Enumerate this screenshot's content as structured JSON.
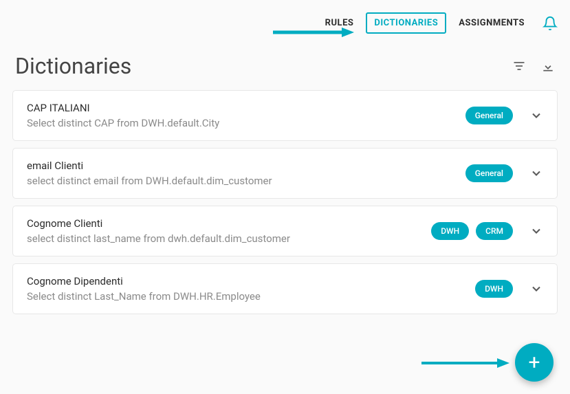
{
  "header": {
    "tabs": [
      {
        "label": "RULES",
        "active": false
      },
      {
        "label": "DICTIONARIES",
        "active": true
      },
      {
        "label": "ASSIGNMENTS",
        "active": false
      }
    ]
  },
  "page": {
    "title": "Dictionaries"
  },
  "items": [
    {
      "title": "CAP ITALIANI",
      "subtitle": "Select distinct CAP from DWH.default.City",
      "chips": [
        "General"
      ]
    },
    {
      "title": "email Clienti",
      "subtitle": "select distinct email from DWH.default.dim_customer",
      "chips": [
        "General"
      ]
    },
    {
      "title": "Cognome Clienti",
      "subtitle": "select distinct last_name from dwh.default.dim_customer",
      "chips": [
        "DWH",
        "CRM"
      ]
    },
    {
      "title": "Cognome Dipendenti",
      "subtitle": "Select distinct Last_Name from DWH.HR.Employee",
      "chips": [
        "DWH"
      ]
    }
  ],
  "fab": {
    "label": "+"
  }
}
